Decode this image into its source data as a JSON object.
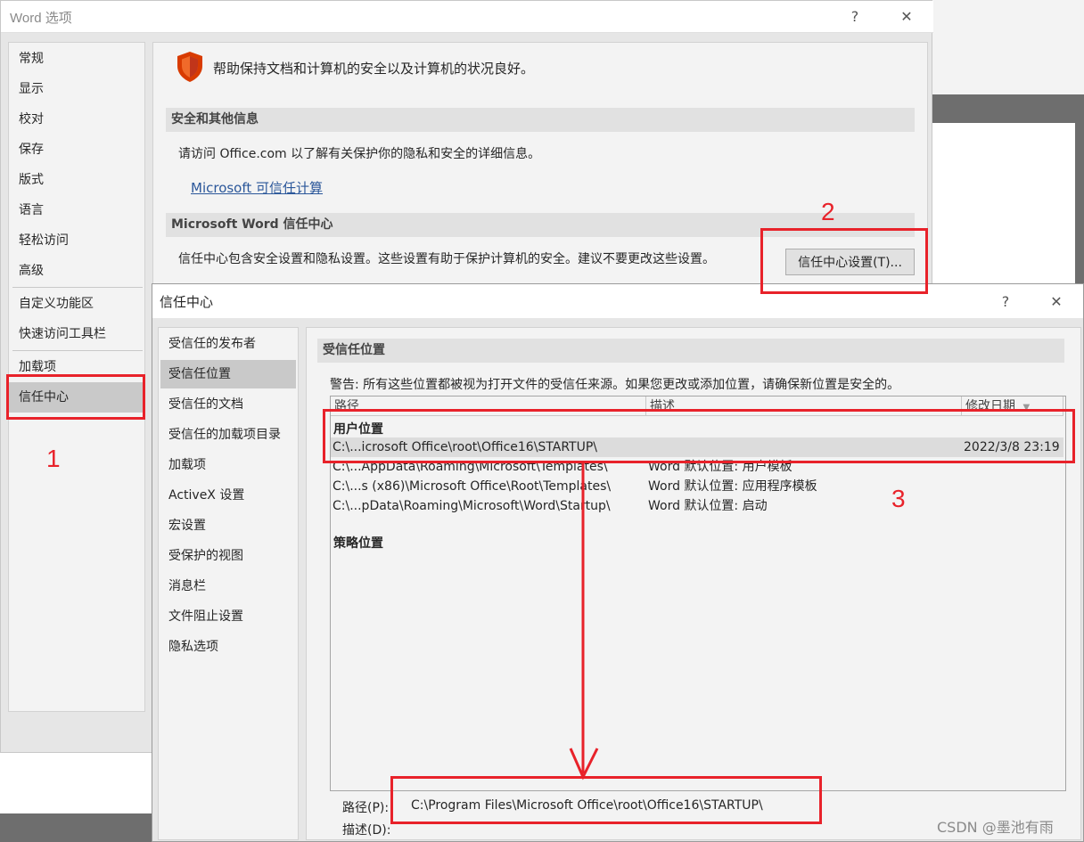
{
  "word_options": {
    "title": "Word 选项",
    "help_glyph": "?",
    "close_glyph": "✕",
    "nav": [
      "常规",
      "显示",
      "校对",
      "保存",
      "版式",
      "语言",
      "轻松访问",
      "高级",
      "自定义功能区",
      "快速访问工具栏",
      "加载项",
      "信任中心"
    ],
    "selected_nav": "信任中心",
    "intro": "帮助保持文档和计算机的安全以及计算机的状况良好。",
    "section1_title": "安全和其他信息",
    "section1_text": "请访问 Office.com 以了解有关保护你的隐私和安全的详细信息。",
    "section1_link": "Microsoft 可信任计算",
    "section2_title": "Microsoft Word 信任中心",
    "section2_text": "信任中心包含安全设置和隐私设置。这些设置有助于保护计算机的安全。建议不要更改这些设置。",
    "trust_button": "信任中心设置(T)..."
  },
  "trust_center": {
    "title": "信任中心",
    "help_glyph": "?",
    "close_glyph": "✕",
    "nav": [
      "受信任的发布者",
      "受信任位置",
      "受信任的文档",
      "受信任的加载项目录",
      "加载项",
      "ActiveX 设置",
      "宏设置",
      "受保护的视图",
      "消息栏",
      "文件阻止设置",
      "隐私选项"
    ],
    "selected_nav": "受信任位置",
    "section_title": "受信任位置",
    "warning": "警告: 所有这些位置都被视为打开文件的受信任来源。如果您更改或添加位置，请确保新位置是安全的。",
    "columns": [
      "路径",
      "描述",
      "修改日期"
    ],
    "group_user": "用户位置",
    "rows": [
      {
        "path": "C:\\...icrosoft Office\\root\\Office16\\STARTUP\\",
        "desc": "",
        "date": "2022/3/8 23:19"
      },
      {
        "path": "C:\\...AppData\\Roaming\\Microsoft\\Templates\\",
        "desc": "Word 默认位置: 用户模板",
        "date": ""
      },
      {
        "path": "C:\\...s (x86)\\Microsoft Office\\Root\\Templates\\",
        "desc": "Word 默认位置: 应用程序模板",
        "date": ""
      },
      {
        "path": "C:\\...pData\\Roaming\\Microsoft\\Word\\Startup\\",
        "desc": "Word 默认位置: 启动",
        "date": ""
      }
    ],
    "group_policy": "策略位置",
    "path_label": "路径(P):",
    "path_value": "C:\\Program Files\\Microsoft Office\\root\\Office16\\STARTUP\\",
    "desc_label": "描述(D):"
  },
  "annotations": {
    "step1": "1",
    "step2": "2",
    "step3": "3",
    "color": "#e8222a"
  },
  "watermark": "CSDN @墨池有雨",
  "colors": {
    "selected": "#c9c9c9",
    "link": "#2b579a",
    "shield": "#d83b01"
  }
}
